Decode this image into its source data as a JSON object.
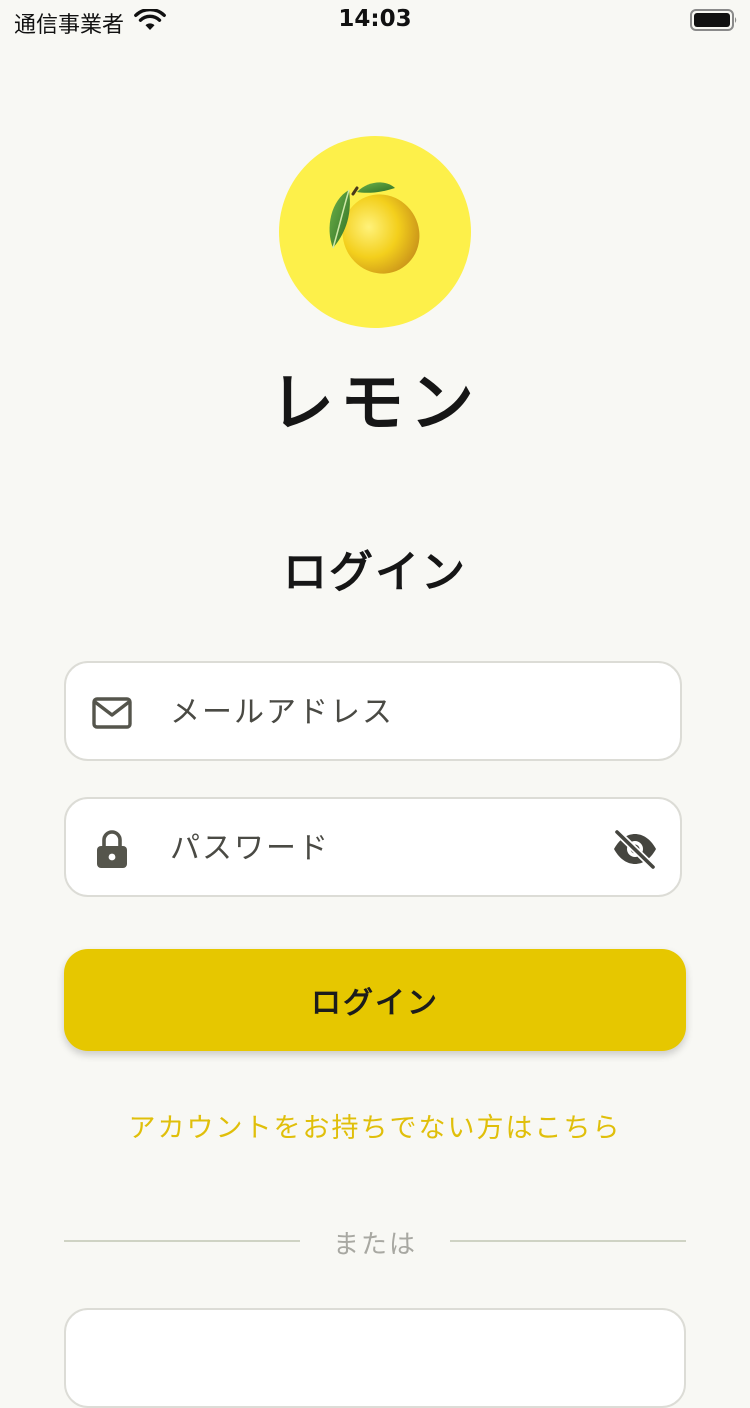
{
  "status_bar": {
    "carrier": "通信事業者",
    "time": "14:03",
    "wifi_icon": "wifi-icon",
    "battery_icon": "battery-icon"
  },
  "logo": {
    "icon": "lemon-icon",
    "background_color": "#fdf04a"
  },
  "app_name": "レモン",
  "screen_title": "ログイン",
  "form": {
    "email": {
      "placeholder": "メールアドレス",
      "value": "",
      "icon": "mail-icon"
    },
    "password": {
      "placeholder": "パスワード",
      "value": "",
      "icon": "lock-icon",
      "toggle_icon": "eye-off-icon"
    },
    "submit_label": "ログイン"
  },
  "signup_link": "アカウントをお持ちでない方はこちら",
  "divider_label": "または",
  "colors": {
    "accent": "#e6c700",
    "link": "#e0bf0a",
    "background": "#f8f8f4"
  }
}
